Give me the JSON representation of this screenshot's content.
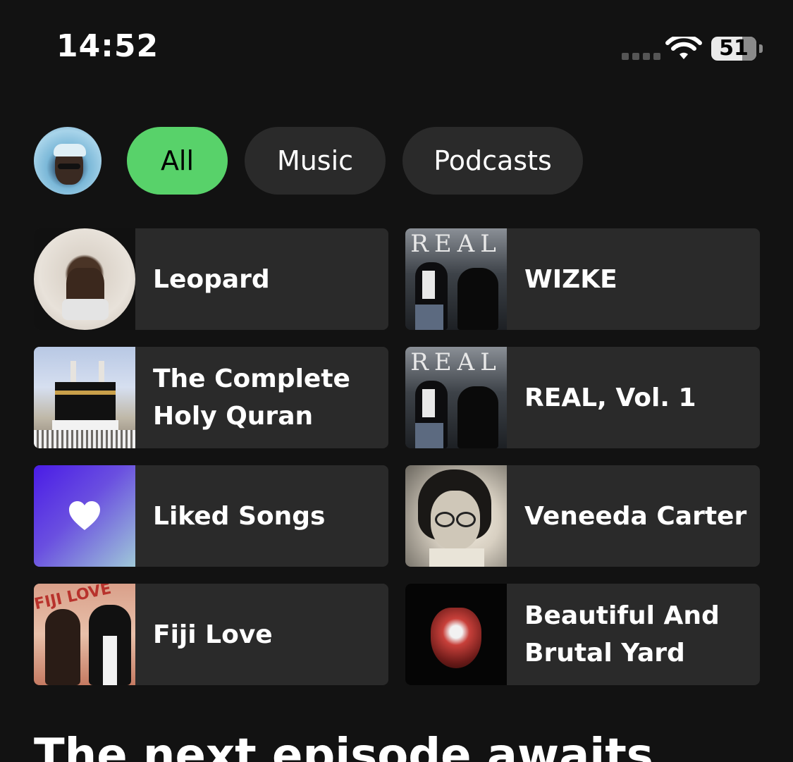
{
  "status_bar": {
    "time": "14:52",
    "battery": "51",
    "icons": [
      "signal-dots-icon",
      "wifi-icon",
      "battery-icon"
    ]
  },
  "filters": {
    "items": [
      {
        "label": "All",
        "selected": true
      },
      {
        "label": "Music",
        "selected": false
      },
      {
        "label": "Podcasts",
        "selected": false
      }
    ],
    "active_color": "#58d26a"
  },
  "shortcuts": [
    {
      "title_lines": [
        "Leopard"
      ]
    },
    {
      "title_lines": [
        "WIZKE"
      ],
      "art_text": "REAL"
    },
    {
      "title_lines": [
        "The Complete",
        "Holy Quran"
      ]
    },
    {
      "title_lines": [
        "REAL, Vol. 1"
      ],
      "art_text": "REAL"
    },
    {
      "title_lines": [
        "Liked Songs"
      ]
    },
    {
      "title_lines": [
        "Veneeda Carter"
      ]
    },
    {
      "title_lines": [
        "Fiji Love"
      ],
      "art_text": "FIJI LOVE"
    },
    {
      "title_lines": [
        "Beautiful And",
        "Brutal Yard"
      ]
    }
  ],
  "section": {
    "title": "The next episode awaits"
  },
  "colors": {
    "background": "#121212",
    "card": "#2a2a2a",
    "chip": "#2a2a2a"
  }
}
